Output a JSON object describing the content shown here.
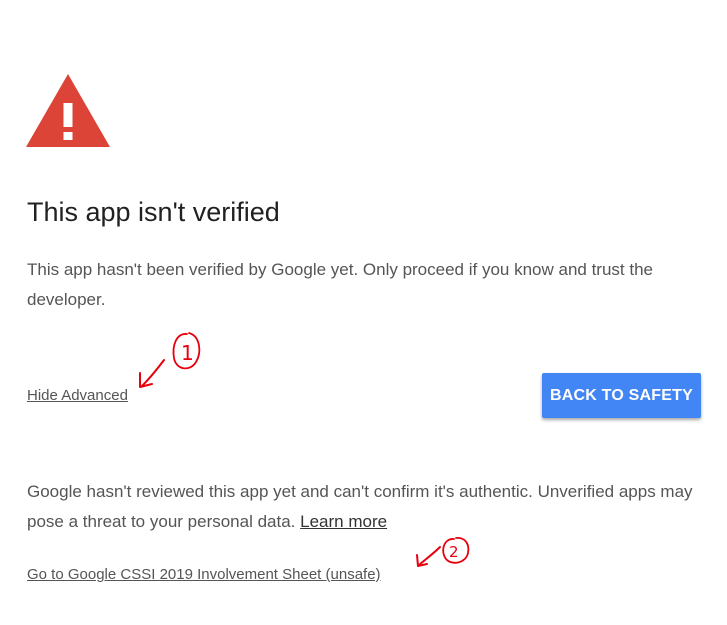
{
  "page": {
    "title": "This app isn't verified",
    "description": "This app hasn't been verified by Google yet. Only proceed if you know and trust the developer.",
    "hide_advanced_label": "Hide Advanced",
    "back_to_safety_label": "BACK TO SAFETY",
    "advanced_text": "Google hasn't reviewed this app yet and can't confirm it's authentic. Unverified apps may pose a threat to your personal data.",
    "learn_more_label": "Learn more",
    "unsafe_link_label": "Go to Google CSSI 2019 Involvement Sheet (unsafe)"
  },
  "icons": {
    "warning": "warning-triangle-icon"
  },
  "annotations": {
    "first": "1",
    "second": "2"
  },
  "colors": {
    "warning_red": "#db4437",
    "button_blue": "#4285f4",
    "annotation_red": "#e8000d"
  }
}
